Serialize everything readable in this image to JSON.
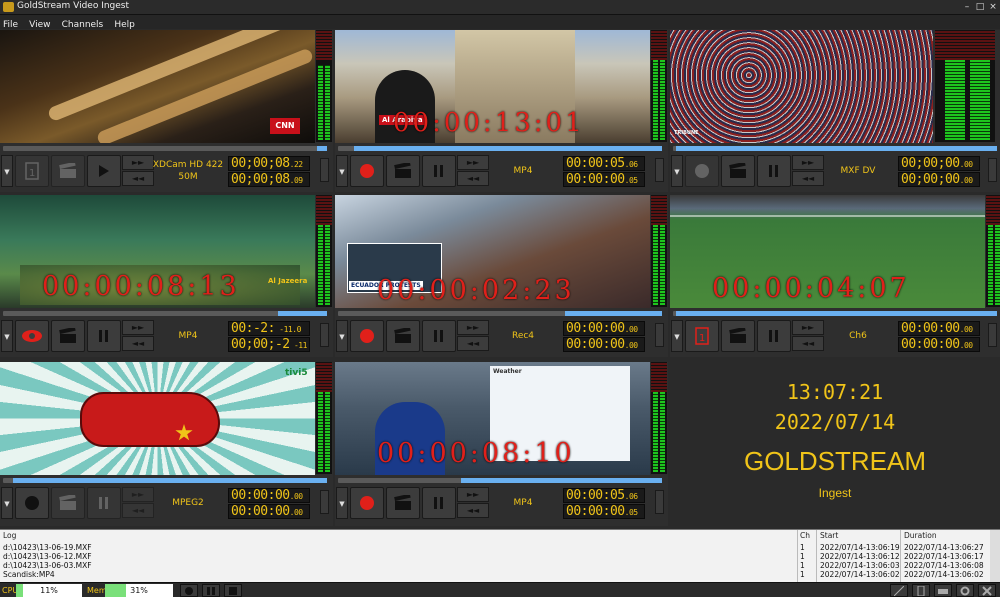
{
  "window": {
    "title": "GoldStream Video Ingest",
    "controls": [
      "minimize",
      "maximize",
      "close"
    ]
  },
  "menu": [
    "File",
    "View",
    "Channels",
    "Help"
  ],
  "channels": [
    {
      "format_line1": "XDCam HD 422",
      "format_line2": "50M",
      "tc1_main": "00;00;08",
      "tc1_frames": "22",
      "tc2_main": "00;00;08",
      "tc2_frames": "09",
      "overlay": "",
      "caption": "CNN",
      "progress": 0.03
    },
    {
      "format_line1": "MP4",
      "format_line2": "",
      "tc1_main": "00:00:05",
      "tc1_frames": "06",
      "tc2_main": "00:00:00",
      "tc2_frames": "05",
      "overlay": "00:00:13:01",
      "caption": "Al Arabiya",
      "progress": 0.95
    },
    {
      "format_line1": "MXF DV",
      "format_line2": "",
      "tc1_main": "00;00;00",
      "tc1_frames": "00",
      "tc2_main": "00;00;00",
      "tc2_frames": "00",
      "overlay": "",
      "caption": "TRIBUNE",
      "progress": 0.99
    },
    {
      "format_line1": "MP4",
      "format_line2": "",
      "tc1_main": "00:-2:",
      "tc1_frames": "-11.0",
      "tc2_main": "00;00;-2",
      "tc2_frames": "-11",
      "overlay": "00:00:08:13",
      "caption": "Al Jazeera",
      "progress": 0.15
    },
    {
      "format_line1": "Rec4",
      "format_line2": "",
      "tc1_main": "00:00:00",
      "tc1_frames": "00",
      "tc2_main": "00:00:00",
      "tc2_frames": "00",
      "overlay": "00:00:02:23",
      "caption": "ECUADOR PROTESTS",
      "progress": 0.3
    },
    {
      "format_line1": "Ch6",
      "format_line2": "",
      "tc1_main": "00:00:00",
      "tc1_frames": "00",
      "tc2_main": "00:00:00",
      "tc2_frames": "00",
      "overlay": "00:00:04:07",
      "caption": "",
      "progress": 0.99
    },
    {
      "format_line1": "MPEG2",
      "format_line2": "",
      "tc1_main": "00:00:00",
      "tc1_frames": "00",
      "tc2_main": "00:00:00",
      "tc2_frames": "00",
      "overlay": "",
      "caption": "tivi5",
      "progress": 0.97
    },
    {
      "format_line1": "MP4",
      "format_line2": "",
      "tc1_main": "00:00:05",
      "tc1_frames": "06",
      "tc2_main": "00:00:00",
      "tc2_frames": "05",
      "overlay": "00:00:08:10",
      "caption": "Weather",
      "progress": 0.62
    }
  ],
  "clock": {
    "time": "13:07:21",
    "date": "2022/07/14",
    "brand": "GOLDSTREAM",
    "subtitle": "Ingest"
  },
  "log": {
    "headers": {
      "log": "Log",
      "ch": "Ch",
      "start": "Start",
      "duration": "Duration"
    },
    "rows": [
      {
        "log": "d:\\10423\\13-06-19.MXF",
        "ch": "1",
        "start": "2022/07/14-13:06:19",
        "duration": "2022/07/14-13:06:27"
      },
      {
        "log": "d:\\10423\\13-06-12.MXF",
        "ch": "1",
        "start": "2022/07/14-13:06:12",
        "duration": "2022/07/14-13:06:17"
      },
      {
        "log": "d:\\10423\\13-06-03.MXF",
        "ch": "1",
        "start": "2022/07/14-13:06:03",
        "duration": "2022/07/14-13:06:08"
      },
      {
        "log": "Scandisk:MP4",
        "ch": "1",
        "start": "2022/07/14-13:06:02",
        "duration": "2022/07/14-13:06:02"
      }
    ]
  },
  "status": {
    "cpu_label": "CPU",
    "cpu_value": "11%",
    "cpu_level": 0.11,
    "mem_label": "Mem",
    "mem_value": "31%",
    "mem_level": 0.31
  },
  "colors": {
    "accent": "#f0c419",
    "record": "#e0201a",
    "meter": "#1ec51e",
    "timeline": "#6ab0f0"
  }
}
